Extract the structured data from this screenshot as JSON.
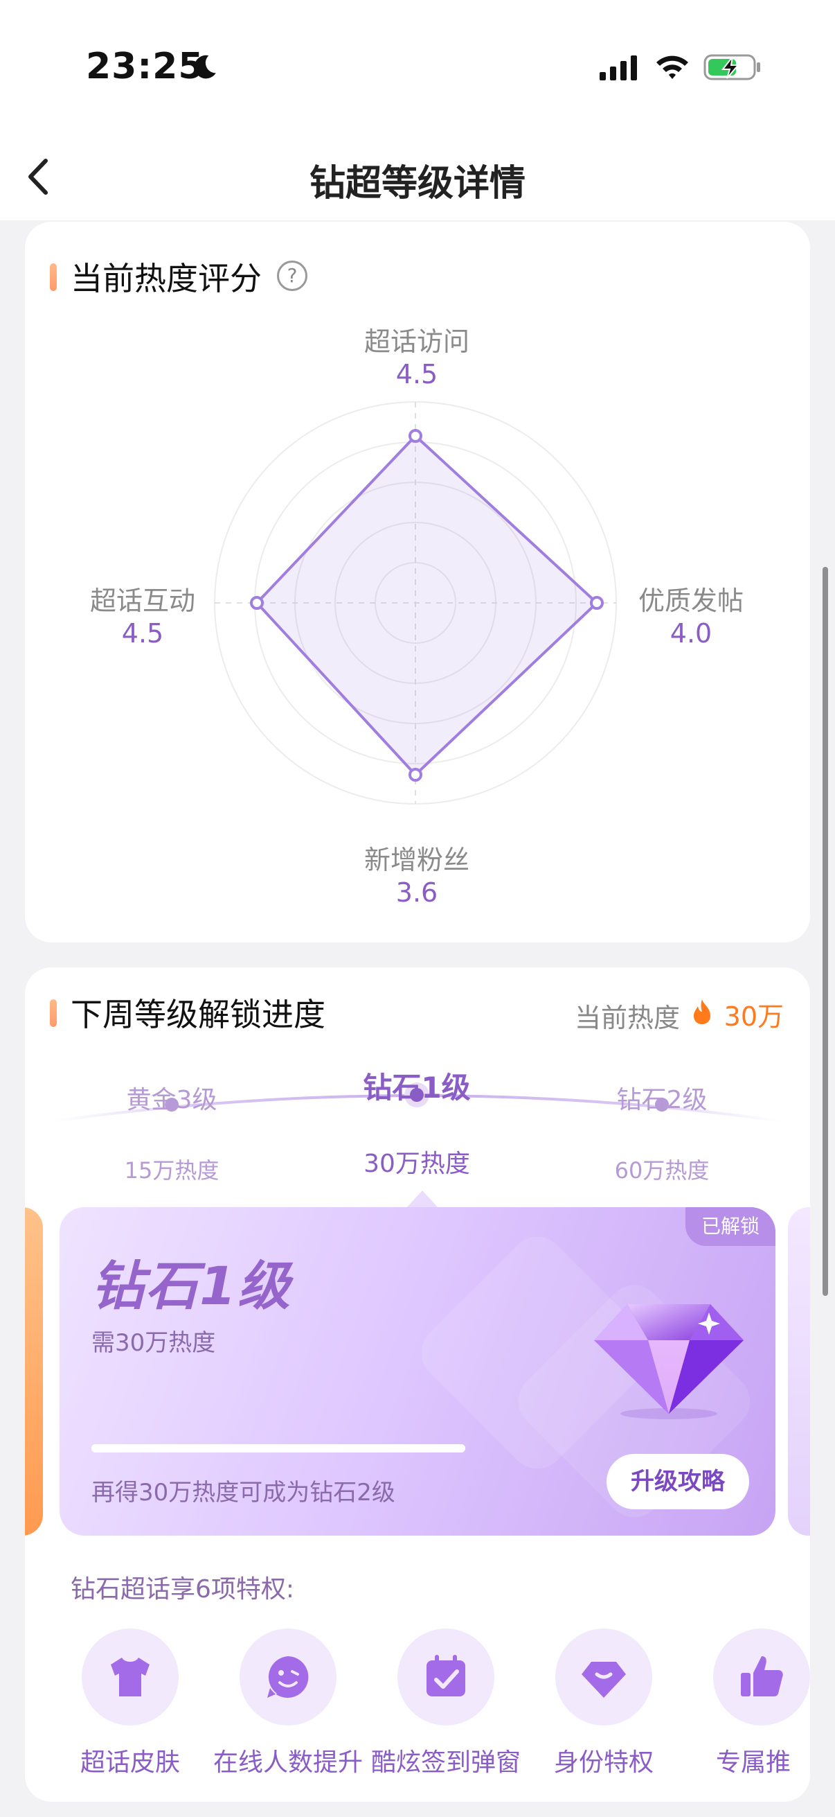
{
  "status_bar": {
    "time": "23:25",
    "icons": [
      "moon-icon",
      "signal-icon",
      "wifi-icon",
      "battery-charging-icon"
    ]
  },
  "nav": {
    "title": "钻超等级详情",
    "back_icon": "chevron-left-icon"
  },
  "score_card": {
    "title": "当前热度评分",
    "help_icon": "question-circle-icon",
    "help_glyph": "?",
    "radar": {
      "axes": [
        {
          "label": "超话访问",
          "value": "4.5"
        },
        {
          "label": "优质发帖",
          "value": "4.0"
        },
        {
          "label": "新增粉丝",
          "value": "3.6"
        },
        {
          "label": "超话互动",
          "value": "4.5"
        }
      ],
      "color": "#a07ee0"
    }
  },
  "unlock_card": {
    "title": "下周等级解锁进度",
    "current_heat_label": "当前热度",
    "current_heat_value": "30万",
    "heat_icon": "fire-icon",
    "levels": [
      {
        "name": "黄金3级",
        "heat": "15万热度"
      },
      {
        "name": "钻石1级",
        "heat": "30万热度"
      },
      {
        "name": "钻石2级",
        "heat": "60万热度"
      }
    ],
    "main": {
      "badge": "已解锁",
      "level": "钻石1级",
      "need": "需30万热度",
      "tip": "再得30万热度可成为钻石2级",
      "progress": 1.0,
      "button": "升级攻略",
      "gem_icon": "diamond-gem-icon"
    },
    "privileges_title": "钻石超话享6项特权:",
    "privileges": [
      {
        "label": "超话皮肤",
        "icon": "tshirt-icon"
      },
      {
        "label": "在线人数提升",
        "icon": "smile-face-icon"
      },
      {
        "label": "酷炫签到弹窗",
        "icon": "calendar-check-icon"
      },
      {
        "label": "身份特权",
        "icon": "diamond-badge-icon"
      },
      {
        "label": "专属推",
        "icon": "thumbs-up-icon"
      }
    ]
  }
}
